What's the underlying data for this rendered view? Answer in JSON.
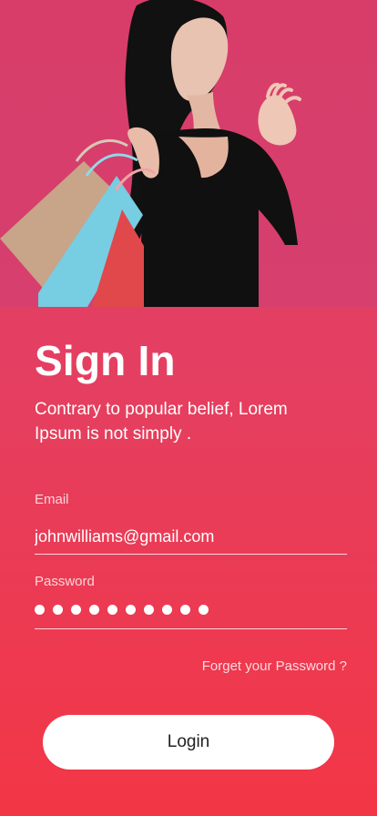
{
  "colors": {
    "background_top": "#df3f6c",
    "background_bottom": "#f33646",
    "button_bg": "#ffffff",
    "button_text": "#222222"
  },
  "header": {
    "image_icon": "shopping-woman-image"
  },
  "signin": {
    "title": "Sign In",
    "subtitle": "Contrary to popular belief, Lorem Ipsum is not simply ."
  },
  "form": {
    "email_label": "Email",
    "email_value": "johnwilliams@gmail.com",
    "password_label": "Password",
    "password_dots": "●●●●●●●●●●",
    "forget_password": "Forget your Password ?",
    "login_button": "Login"
  }
}
